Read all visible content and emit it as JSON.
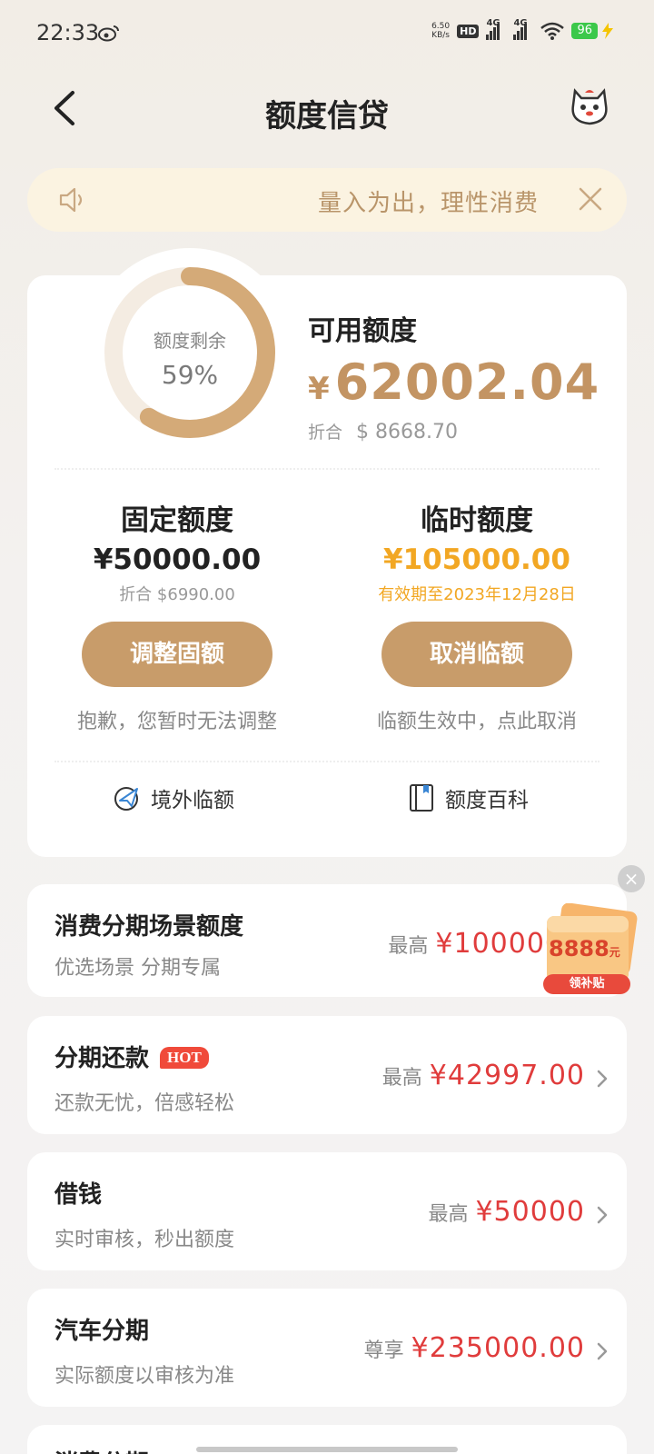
{
  "status_bar": {
    "time": "22:33",
    "net_speed_value": "6.50",
    "net_speed_unit": "KB/s",
    "hd": "HD",
    "signal1": "4G",
    "signal2": "4G",
    "battery": "96"
  },
  "header": {
    "title": "额度信贷"
  },
  "notice": {
    "text": "量入为出，理性消费"
  },
  "credit": {
    "ring_label": "额度剩余",
    "ring_percent": "59%",
    "ring_fraction": 0.59,
    "available_label": "可用额度",
    "available_currency": "¥",
    "available_amount": "62002.04",
    "usd_label": "折合",
    "usd_amount": "$ 8668.70",
    "fixed": {
      "title": "固定额度",
      "amount": "¥50000.00",
      "sub": "折合 $6990.00",
      "button": "调整固额",
      "tip": "抱歉，您暂时无法调整"
    },
    "temp": {
      "title": "临时额度",
      "amount": "¥105000.00",
      "sub": "有效期至2023年12月28日",
      "button": "取消临额",
      "tip": "临额生效中，点此取消"
    },
    "links": {
      "overseas": "境外临额",
      "wiki": "额度百科"
    }
  },
  "products": [
    {
      "title": "消费分期场景额度",
      "subtitle": "优选场景 分期专属",
      "prefix": "最高",
      "value": "¥100000"
    },
    {
      "title": "分期还款",
      "badge": "HOT",
      "subtitle": "还款无忧，倍感轻松",
      "prefix": "最高",
      "value": "¥42997.00"
    },
    {
      "title": "借钱",
      "subtitle": "实时审核，秒出额度",
      "prefix": "最高",
      "value": "¥50000"
    },
    {
      "title": "汽车分期",
      "subtitle": "实际额度以审核为准",
      "prefix": "尊享",
      "value": "¥235000.00"
    },
    {
      "title": "消费分期"
    }
  ],
  "promo": {
    "amount": "8888",
    "unit": "元",
    "label": "领补贴"
  },
  "colors": {
    "gold": "#c89c6a",
    "orange": "#f2a723",
    "red": "#e03c3c"
  }
}
